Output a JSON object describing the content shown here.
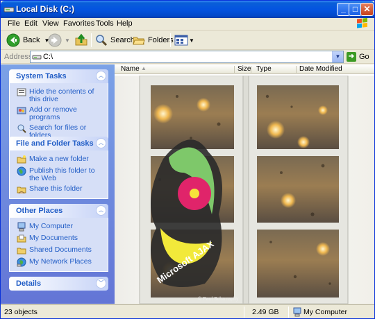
{
  "window": {
    "title": "Local Disk (C:)"
  },
  "title_buttons": {
    "minimize": "_",
    "maximize": "□",
    "close": "✕"
  },
  "menu": {
    "items": [
      "File",
      "Edit",
      "View",
      "Favorites",
      "Tools",
      "Help"
    ]
  },
  "toolbar": {
    "back_label": "Back",
    "search_label": "Search",
    "folders_label": "Folders"
  },
  "address": {
    "label": "Address",
    "value": "C:\\",
    "go_label": "Go"
  },
  "system_tasks": {
    "title": "System Tasks",
    "items": [
      "Hide the contents of this drive",
      "Add or remove programs",
      "Search for files or folders"
    ]
  },
  "file_folder_tasks": {
    "title": "File and Folder Tasks",
    "items": [
      "Make a new folder",
      "Publish this folder to the Web",
      "Share this folder"
    ]
  },
  "other_places": {
    "title": "Other Places",
    "items": [
      "My Computer",
      "My Documents",
      "Shared Documents",
      "My Network Places"
    ]
  },
  "details": {
    "title": "Details"
  },
  "columns": {
    "name": "Name",
    "size": "Size",
    "type": "Type",
    "date": "Date Modified"
  },
  "watermark": {
    "logo_text": "Microsoft AJAX",
    "credit": "© Paul Scha     raphy"
  },
  "status": {
    "objects": "23 objects",
    "size": "2.49 GB",
    "location": "My Computer"
  },
  "colors": {
    "title_blue": "#0454e0",
    "panel_link": "#215dc6",
    "task_pane": "#7ba2e7"
  }
}
